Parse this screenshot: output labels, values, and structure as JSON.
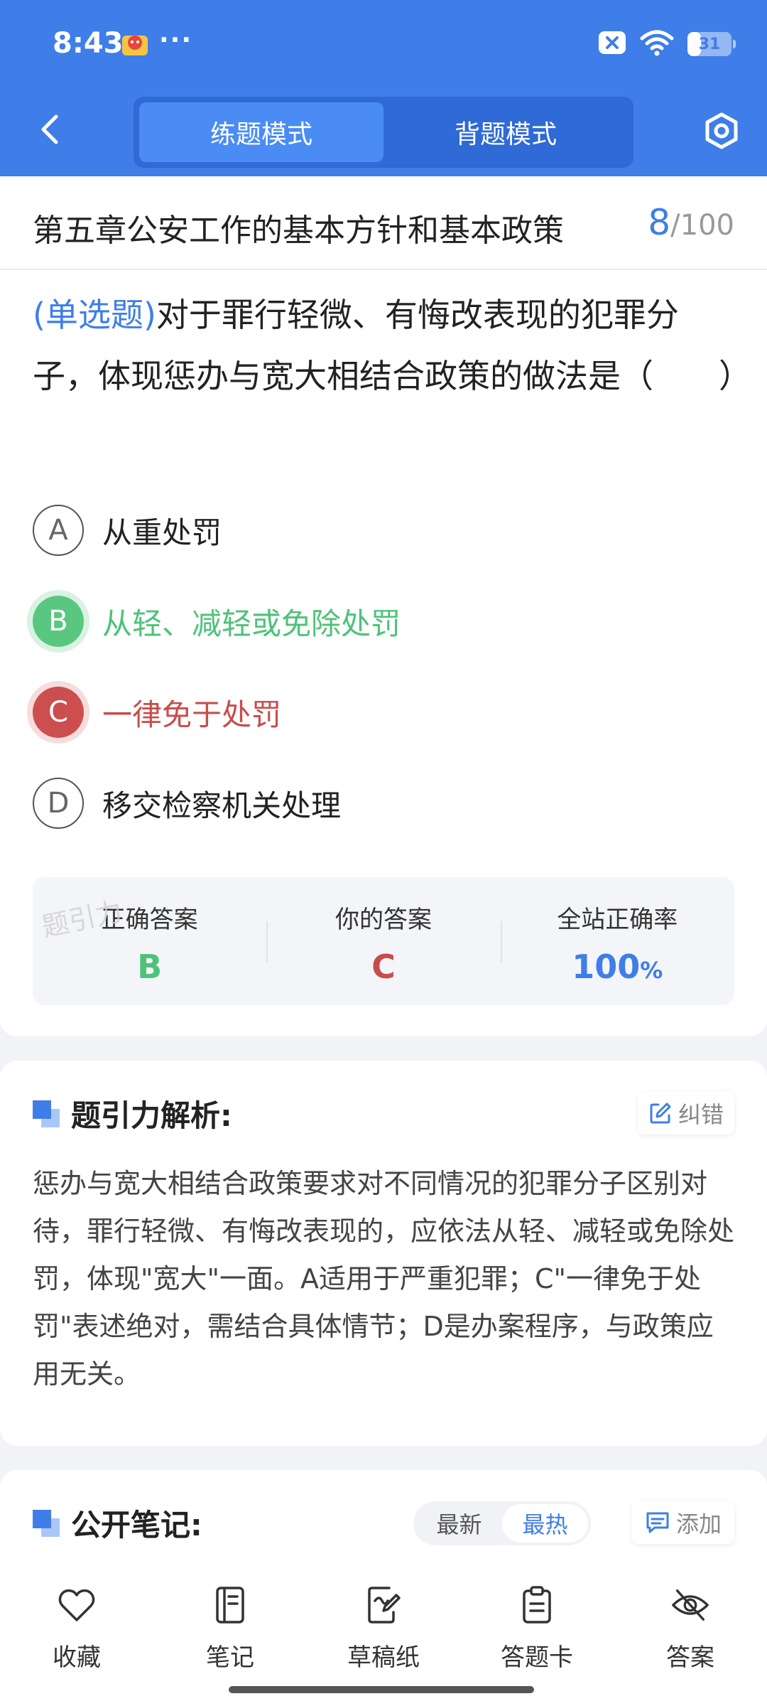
{
  "status_bar": {
    "time": "8:43",
    "dots": "···",
    "battery": "31"
  },
  "nav": {
    "tabs": [
      {
        "label": "练题模式",
        "active": true
      },
      {
        "label": "背题模式",
        "active": false
      }
    ]
  },
  "chapter": {
    "title": "第五章公安工作的基本方针和基本政策",
    "current": "8",
    "total": "/100"
  },
  "question": {
    "type": "(单选题)",
    "text": "对于罪行轻微、有悔改表现的犯罪分子，体现惩办与宽大相结合政策的做法是（　　）"
  },
  "options": [
    {
      "letter": "A",
      "text": "从重处罚",
      "state": "normal"
    },
    {
      "letter": "B",
      "text": "从轻、减轻或免除处罚",
      "state": "correct"
    },
    {
      "letter": "C",
      "text": "一律免于处罚",
      "state": "wrong"
    },
    {
      "letter": "D",
      "text": "移交检察机关处理",
      "state": "normal"
    }
  ],
  "stats": {
    "correct_label": "正确答案",
    "correct_value": "B",
    "yours_label": "你的答案",
    "yours_value": "C",
    "rate_label": "全站正确率",
    "rate_value": "100",
    "rate_unit": "%"
  },
  "watermark": "题引力",
  "analysis": {
    "title": "题引力解析:",
    "correct_btn": "纠错",
    "text": "惩办与宽大相结合政策要求对不同情况的犯罪分子区别对待，罪行轻微、有悔改表现的，应依法从轻、减轻或免除处罚，体现\"宽大\"一面。A适用于严重犯罪；C\"一律免于处罚\"表述绝对，需结合具体情节；D是办案程序，与政策应用无关。"
  },
  "notes": {
    "title": "公开笔记:",
    "sort": [
      {
        "label": "最新",
        "active": false
      },
      {
        "label": "最热",
        "active": true
      }
    ],
    "add_btn": "添加"
  },
  "bottom_nav": [
    {
      "label": "收藏",
      "icon": "heart-icon"
    },
    {
      "label": "笔记",
      "icon": "notebook-icon"
    },
    {
      "label": "草稿纸",
      "icon": "draft-paper-icon"
    },
    {
      "label": "答题卡",
      "icon": "answer-card-icon"
    },
    {
      "label": "答案",
      "icon": "eye-off-icon"
    }
  ],
  "colors": {
    "accent": "#3f7ee8",
    "correct": "#4ec27a",
    "wrong": "#c94c4c"
  }
}
